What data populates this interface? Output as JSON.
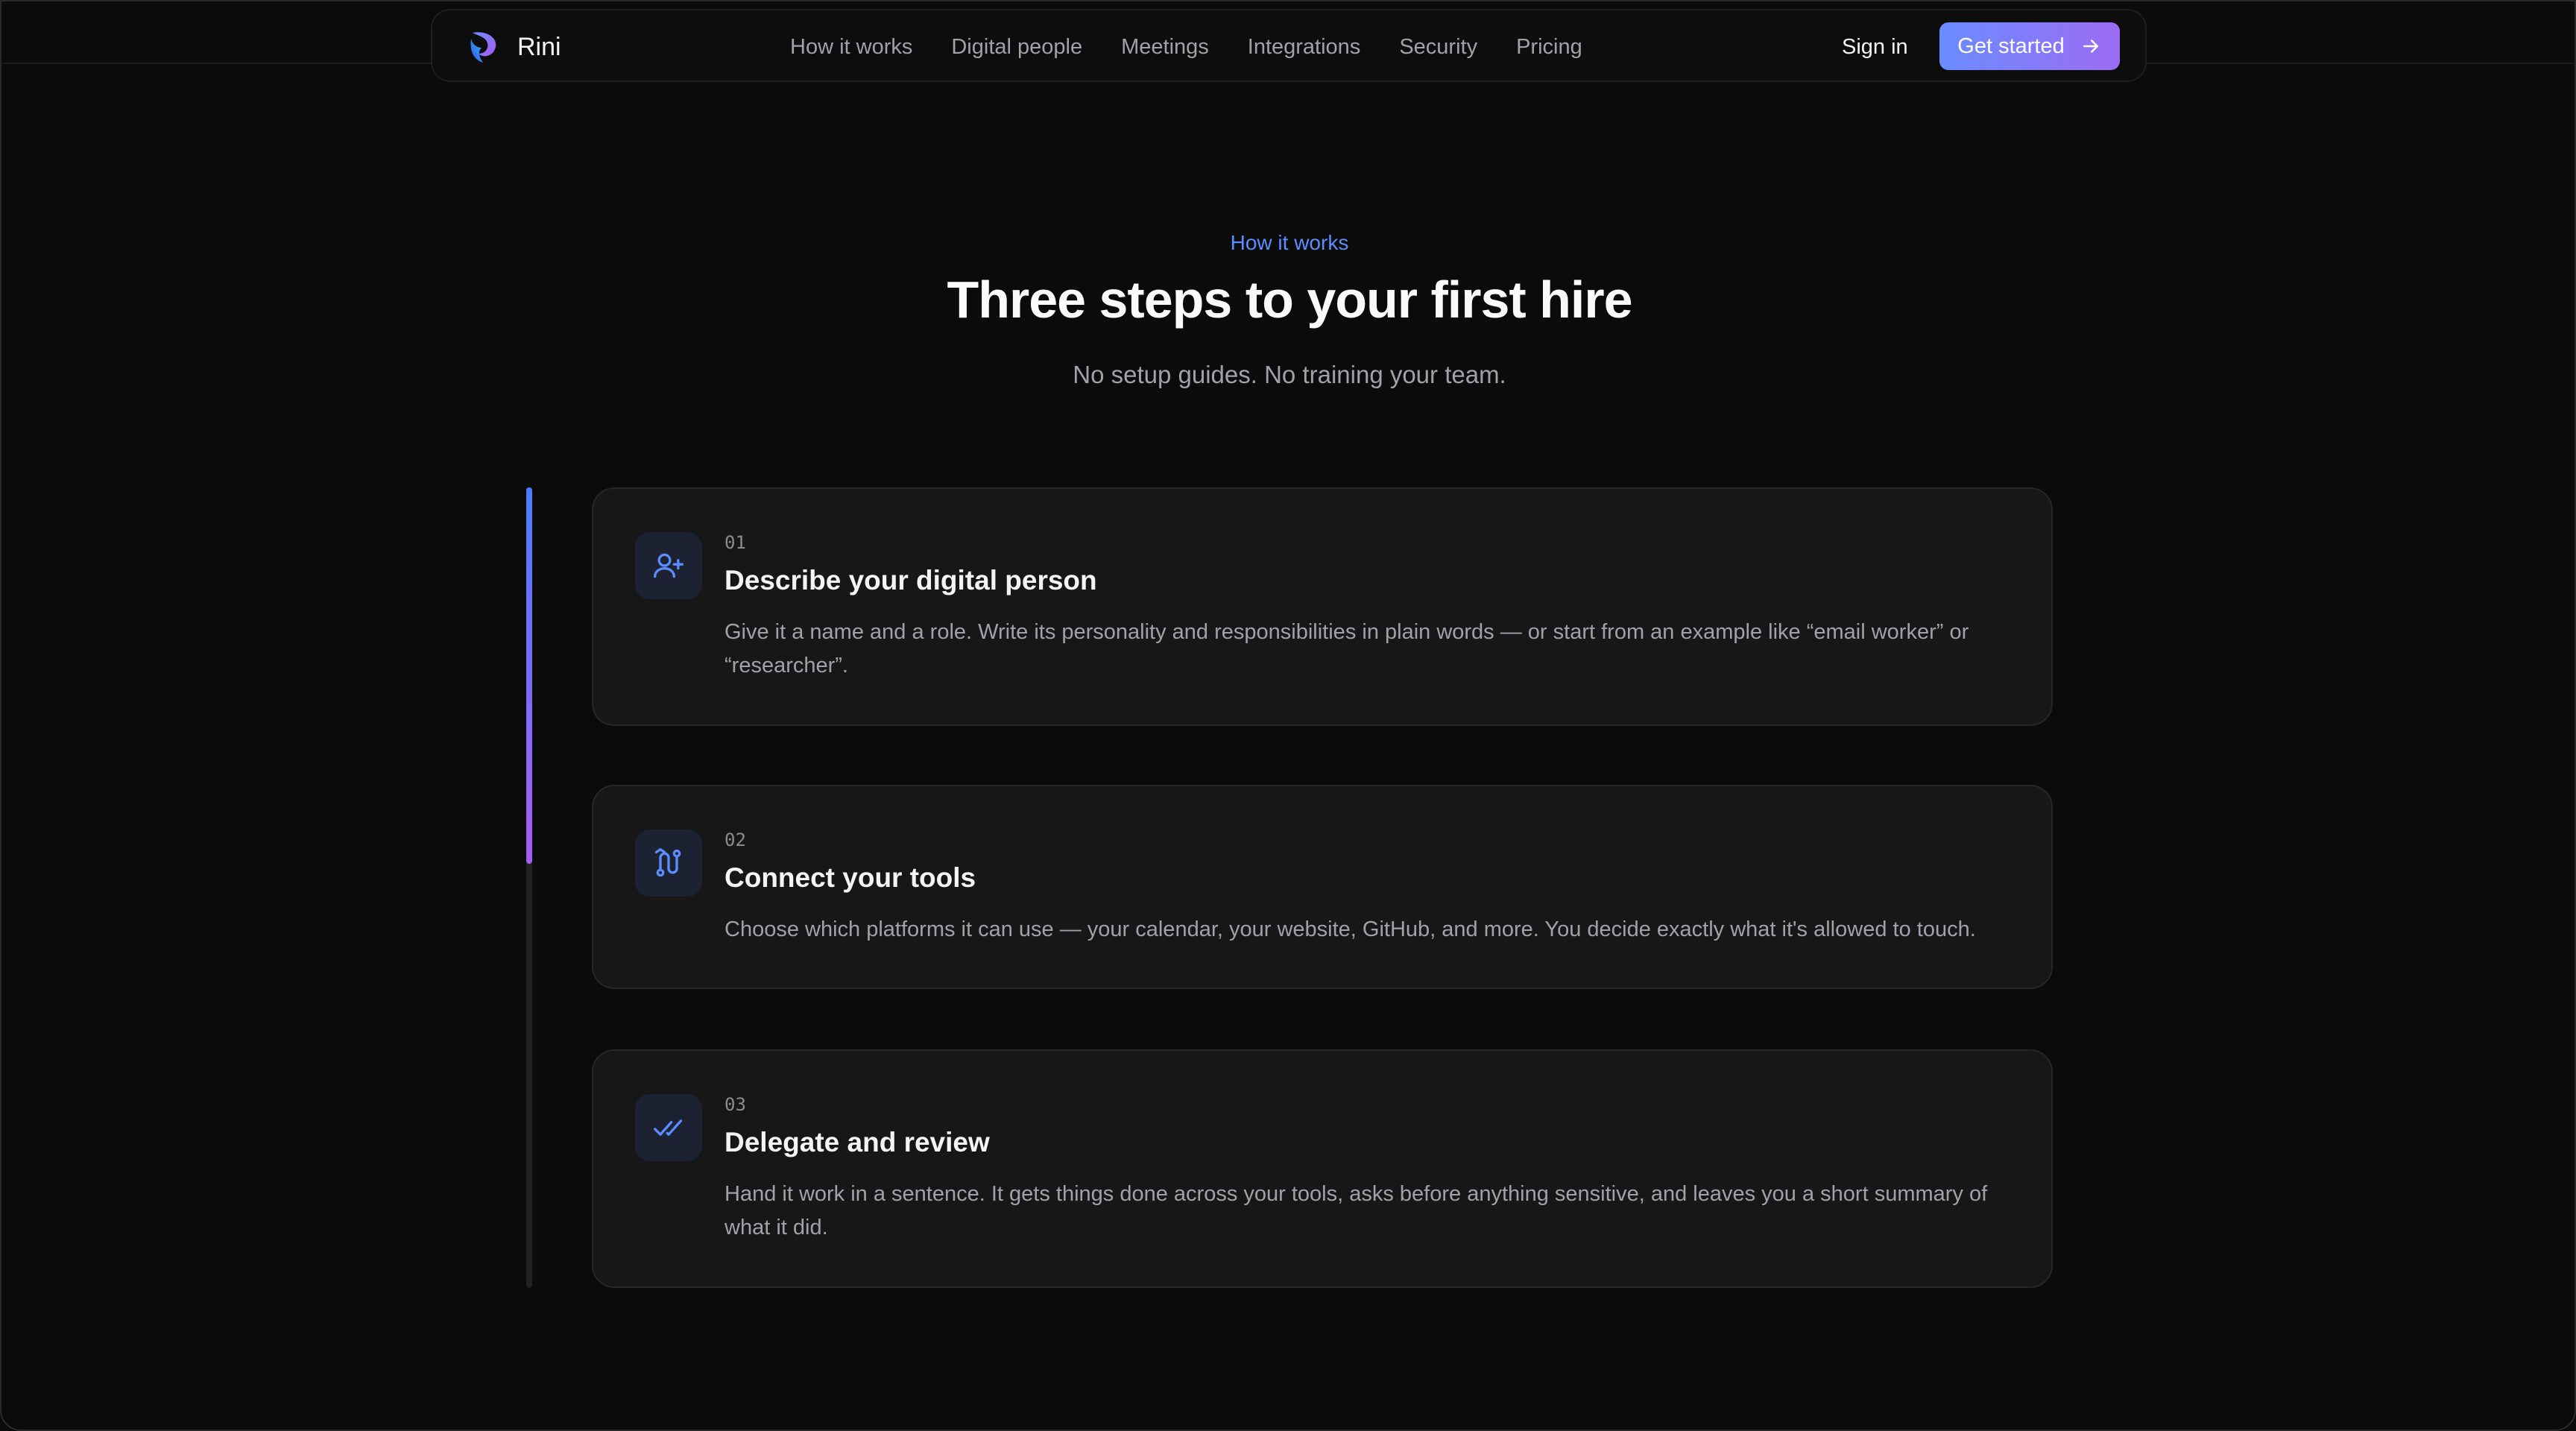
{
  "brand": {
    "name": "Rini"
  },
  "nav": {
    "items": [
      {
        "label": "How it works"
      },
      {
        "label": "Digital people"
      },
      {
        "label": "Meetings"
      },
      {
        "label": "Integrations"
      },
      {
        "label": "Security"
      },
      {
        "label": "Pricing"
      }
    ],
    "sign_in": "Sign in",
    "cta": "Get started"
  },
  "hero": {
    "eyebrow": "How it works",
    "title": "Three steps to your first hire",
    "subtitle": "No setup guides. No training your team."
  },
  "timeline": {
    "progress_fraction": 0.47
  },
  "steps": [
    {
      "number": "01",
      "title": "Describe your digital person",
      "description": "Give it a name and a role. Write its personality and responsibilities in plain words — or start from an example like “email worker” or “researcher”.",
      "icon": "user-plus-icon"
    },
    {
      "number": "02",
      "title": "Connect your tools",
      "description": "Choose which platforms it can use — your calendar, your website, GitHub, and more. You decide exactly what it's allowed to touch.",
      "icon": "route-icon"
    },
    {
      "number": "03",
      "title": "Delegate and review",
      "description": "Hand it work in a sentence. It gets things done across your tools, asks before anything sensitive, and leaves you a short summary of what it did.",
      "icon": "double-check-icon"
    }
  ],
  "colors": {
    "accent": "#5b8dff",
    "accent_purple": "#a55cf0",
    "background": "#0b0b0b",
    "card": "#171717"
  }
}
